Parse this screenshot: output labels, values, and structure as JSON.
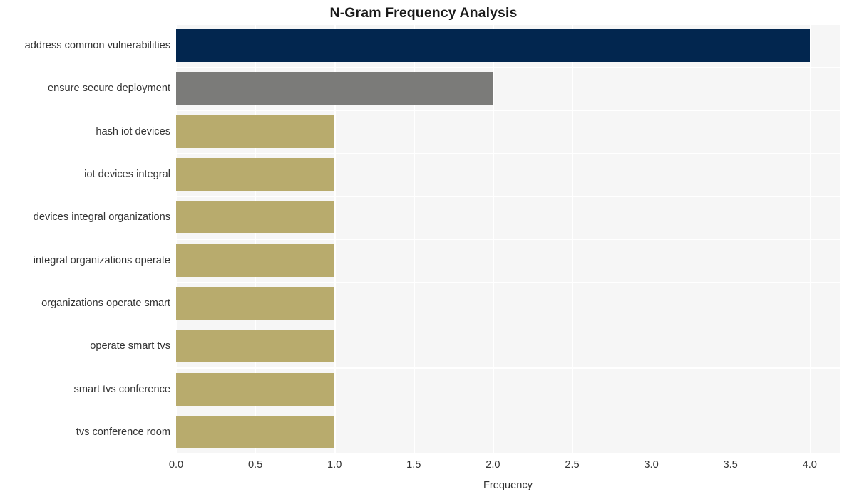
{
  "chart_data": {
    "type": "bar",
    "orientation": "horizontal",
    "title": "N-Gram Frequency Analysis",
    "xlabel": "Frequency",
    "ylabel": "",
    "xlim": [
      0,
      4.19
    ],
    "xticks": [
      "0.0",
      "0.5",
      "1.0",
      "1.5",
      "2.0",
      "2.5",
      "3.0",
      "3.5",
      "4.0"
    ],
    "xtick_values": [
      0,
      0.5,
      1,
      1.5,
      2,
      2.5,
      3,
      3.5,
      4
    ],
    "grid": true,
    "legend": "none",
    "categories": [
      "address common vulnerabilities",
      "ensure secure deployment",
      "hash iot devices",
      "iot devices integral",
      "devices integral organizations",
      "integral organizations operate",
      "organizations operate smart",
      "operate smart tvs",
      "smart tvs conference",
      "tvs conference room"
    ],
    "values": [
      4,
      2,
      1,
      1,
      1,
      1,
      1,
      1,
      1,
      1
    ],
    "bar_colors": [
      "#02264f",
      "#7b7b79",
      "#b8ab6d",
      "#b8ab6d",
      "#b8ab6d",
      "#b8ab6d",
      "#b8ab6d",
      "#b8ab6d",
      "#b8ab6d",
      "#b8ab6d"
    ],
    "plot_background": "#f6f6f6",
    "gridline_color": "#ffffff",
    "figure_background": "#ffffff",
    "text_color": "#333333",
    "title_color": "#1a1a1a"
  }
}
